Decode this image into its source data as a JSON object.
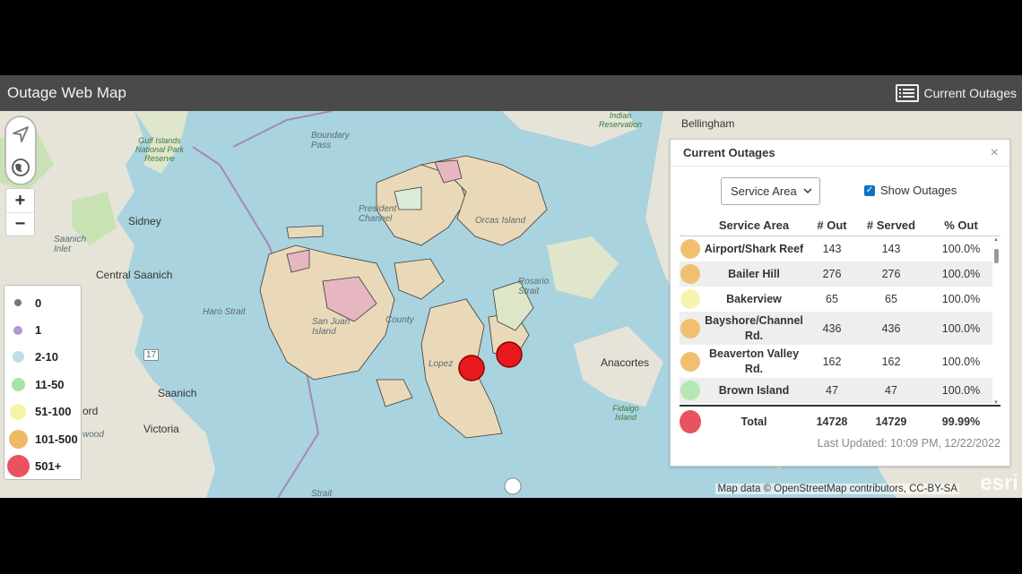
{
  "app": {
    "title": "Outage Web Map",
    "current_outages_label": "Current Outages"
  },
  "map": {
    "labels": {
      "bellingham": "Bellingham",
      "sidney": "Sidney",
      "central_saanich": "Central Saanich",
      "saanich": "Saanich",
      "victoria": "Victoria",
      "ord": "ord",
      "wood": "wood",
      "anacortes": "Anacortes",
      "orcas_island": "Orcas Island",
      "san_juan_island": "San Juan Island",
      "gulf_islands_park": "Gulf Islands National Park Reserve",
      "fidalgo_island": "Fidalgo Island",
      "indian_reservation": "Indian Reservation",
      "haro_strait": "Haro Strait",
      "rosario_strait": "Rosario Strait",
      "boundary_pass": "Boundary Pass",
      "president_channel": "President Channel",
      "saanich_inlet": "Saanich Inlet",
      "lopez": "Lopez",
      "strait": "Strait",
      "county": "County",
      "route_17": "17"
    },
    "outage_markers": [
      {
        "label": "Lopez Island large outage",
        "color": "#e8191d"
      },
      {
        "label": "Decatur area large outage",
        "color": "#e8191d"
      }
    ],
    "attribution": "Map data © OpenStreetMap contributors, CC-BY-SA",
    "esri_logo": "esri"
  },
  "controls": {
    "navigate_icon": "navigation-arrow-icon",
    "globe_icon": "globe-icon",
    "zoom_in": "+",
    "zoom_out": "−"
  },
  "legend": [
    {
      "label": "0",
      "color": "#777777",
      "size": 8
    },
    {
      "label": "1",
      "color": "#b695d6",
      "size": 10
    },
    {
      "label": "2-10",
      "color": "#bde0e8",
      "size": 13
    },
    {
      "label": "11-50",
      "color": "#a6e3a6",
      "size": 15
    },
    {
      "label": "51-100",
      "color": "#f6f3a6",
      "size": 18
    },
    {
      "label": "101-500",
      "color": "#f0b968",
      "size": 21
    },
    {
      "label": "501+",
      "color": "#e8535f",
      "size": 25
    }
  ],
  "panel": {
    "title": "Current Outages",
    "close": "×",
    "select_value": "Service Area",
    "show_outages_label": "Show Outages",
    "show_outages_checked": true,
    "columns": [
      "Service Area",
      "# Out",
      "# Served",
      "% Out"
    ],
    "rows": [
      {
        "area": "Airport/Shark Reef",
        "out": "143",
        "served": "143",
        "pct": "100.0%",
        "color": "#f0c070"
      },
      {
        "area": "Bailer Hill",
        "out": "276",
        "served": "276",
        "pct": "100.0%",
        "color": "#f0c070"
      },
      {
        "area": "Bakerview",
        "out": "65",
        "served": "65",
        "pct": "100.0%",
        "color": "#f6f3b0"
      },
      {
        "area": "Bayshore/Channel Rd.",
        "out": "436",
        "served": "436",
        "pct": "100.0%",
        "color": "#f0c070"
      },
      {
        "area": "Beaverton Valley Rd.",
        "out": "162",
        "served": "162",
        "pct": "100.0%",
        "color": "#f0c070"
      },
      {
        "area": "Brown Island",
        "out": "47",
        "served": "47",
        "pct": "100.0%",
        "color": "#b5e8b5"
      }
    ],
    "total": {
      "label": "Total",
      "out": "14728",
      "served": "14729",
      "pct": "99.99%",
      "color": "#e8535f"
    },
    "last_updated": "Last Updated: 10:09 PM, 12/22/2022"
  }
}
